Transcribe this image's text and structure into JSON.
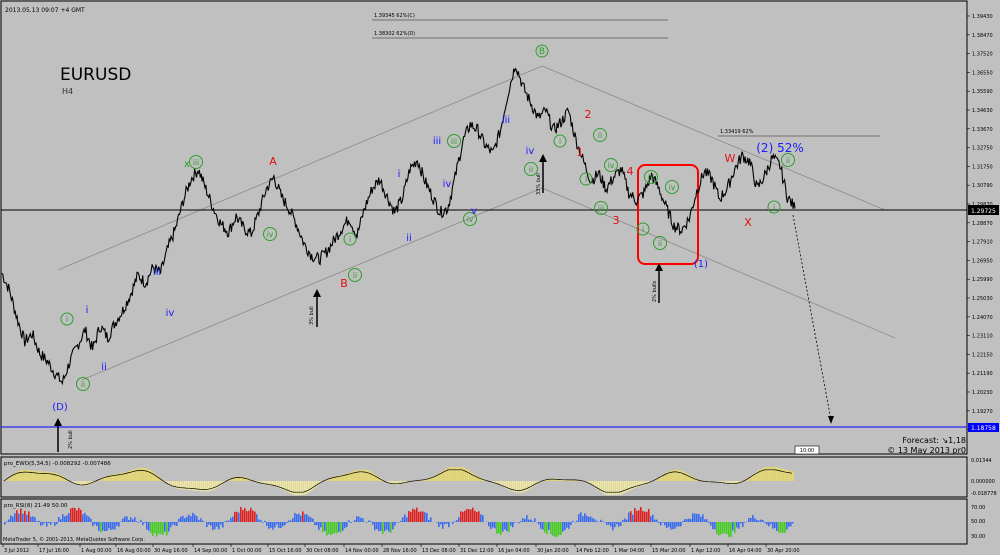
{
  "header": {
    "timestamp": "2013.05.13 09:07 +4 GMT",
    "symbol": "EURUSD",
    "timeframe": "H4",
    "fib_1": "1.39345 62%(C)",
    "fib_2": "1.38302 62%(D)",
    "fib_3": "1.33419 62%"
  },
  "price_axis": {
    "labels": [
      "1.39430",
      "1.38470",
      "1.37520",
      "1.36550",
      "1.35590",
      "1.34630",
      "1.33670",
      "1.32750",
      "1.31750",
      "1.30790",
      "1.29870",
      "1.28870",
      "1.27910",
      "1.26950",
      "1.25990",
      "1.25030",
      "1.24070",
      "1.23110",
      "1.22150",
      "1.21190",
      "1.20230",
      "1.19270",
      "1.18310"
    ],
    "current_price": "1.29725",
    "forecast_price": "1.18758"
  },
  "time_axis": {
    "labels": [
      "3 Jul 2012",
      "17 Jul 16:00",
      "1 Aug 00:00",
      "16 Aug 00:00",
      "30 Aug 16:00",
      "14 Sep 00:00",
      "1 Oct 00:00",
      "15 Oct 16:00",
      "30 Oct 08:00",
      "14 Nov 00:00",
      "28 Nov 16:00",
      "13 Dec 08:00",
      "31 Dec 12:00",
      "16 Jan 04:00",
      "30 Jan 20:00",
      "14 Feb 12:00",
      "1 Mar 04:00",
      "15 Mar 20:00",
      "1 Apr 12:00",
      "16 Apr 04:00",
      "30 Apr 20:00"
    ]
  },
  "forecast": {
    "line1": "Forecast: ↘1,18",
    "line2": "© 13 May 2013 pr0"
  },
  "scroll_label": "10:00",
  "indicators": {
    "ewo": {
      "label": "pro_EWO(5,34,5) -0.008292 -0.007486",
      "axis": [
        "0.000000",
        "-0.018778"
      ],
      "top_value": "0.01344"
    },
    "rsi": {
      "label": "pro_RSI(8) 21.49 50.00",
      "axis": [
        "70.00",
        "50.00",
        "30.00"
      ]
    }
  },
  "footer": {
    "copyright": "MetaTrader 5, © 2001-2013, MetaQuotes Software Corp."
  },
  "wave_labels": [
    {
      "text": "(D)",
      "kind": "blue"
    },
    {
      "text": "i",
      "kind": "green"
    },
    {
      "text": "ii",
      "kind": "green"
    },
    {
      "text": "i",
      "kind": "blue"
    },
    {
      "text": "ii",
      "kind": "blue"
    },
    {
      "text": "iii",
      "kind": "blue"
    },
    {
      "text": "iv",
      "kind": "blue"
    },
    {
      "text": "x",
      "kind": "green-plain"
    },
    {
      "text": "iii",
      "kind": "green"
    },
    {
      "text": "A",
      "kind": "red"
    },
    {
      "text": "iv",
      "kind": "green"
    },
    {
      "text": "B",
      "kind": "red"
    },
    {
      "text": "i",
      "kind": "green"
    },
    {
      "text": "ii",
      "kind": "green"
    },
    {
      "text": "i",
      "kind": "blue"
    },
    {
      "text": "ii",
      "kind": "blue"
    },
    {
      "text": "iii",
      "kind": "blue"
    },
    {
      "text": "iii",
      "kind": "green"
    },
    {
      "text": "iv",
      "kind": "blue"
    },
    {
      "text": "iv",
      "kind": "green"
    },
    {
      "text": "v",
      "kind": "blue"
    },
    {
      "text": "iii",
      "kind": "blue"
    },
    {
      "text": "iv",
      "kind": "blue"
    },
    {
      "text": "ii",
      "kind": "green"
    },
    {
      "text": "B",
      "kind": "green"
    },
    {
      "text": "i",
      "kind": "green"
    },
    {
      "text": "2",
      "kind": "red"
    },
    {
      "text": "ii",
      "kind": "green"
    },
    {
      "text": "1",
      "kind": "red"
    },
    {
      "text": "iv",
      "kind": "green"
    },
    {
      "text": "i",
      "kind": "green"
    },
    {
      "text": "iii",
      "kind": "green"
    },
    {
      "text": "3",
      "kind": "red"
    },
    {
      "text": "4",
      "kind": "red"
    },
    {
      "text": "iii",
      "kind": "green"
    },
    {
      "text": "iv",
      "kind": "green"
    },
    {
      "text": "i",
      "kind": "green"
    },
    {
      "text": "ii",
      "kind": "green"
    },
    {
      "text": "(1)",
      "kind": "blue"
    },
    {
      "text": "W",
      "kind": "red"
    },
    {
      "text": "X",
      "kind": "red"
    },
    {
      "text": "(2) 52%",
      "kind": "blue"
    },
    {
      "text": "ii",
      "kind": "green"
    },
    {
      "text": "i",
      "kind": "green"
    }
  ],
  "arrow_notes": [
    "2% bull",
    "3% bull",
    "33% bull",
    "2% bulls"
  ],
  "chart_data": {
    "type": "line",
    "title": "EURUSD",
    "xlabel": "",
    "ylabel": "",
    "ylim": [
      1.1813,
      1.3943
    ],
    "series": [
      {
        "values": [
          1.263,
          1.254,
          1.24,
          1.228,
          1.232,
          1.222,
          1.218,
          1.212,
          1.207,
          1.218,
          1.226,
          1.234,
          1.224,
          1.236,
          1.23,
          1.238,
          1.244,
          1.252,
          1.262,
          1.258,
          1.266,
          1.263,
          1.276,
          1.286,
          1.3,
          1.311,
          1.316,
          1.306,
          1.296,
          1.288,
          1.284,
          1.292,
          1.286,
          1.283,
          1.294,
          1.306,
          1.312,
          1.302,
          1.296,
          1.288,
          1.278,
          1.272,
          1.27,
          1.274,
          1.28,
          1.286,
          1.291,
          1.282,
          1.296,
          1.306,
          1.311,
          1.302,
          1.294,
          1.301,
          1.316,
          1.321,
          1.31,
          1.302,
          1.294,
          1.296,
          1.312,
          1.33,
          1.339,
          1.336,
          1.328,
          1.324,
          1.336,
          1.355,
          1.37,
          1.358,
          1.35,
          1.342,
          1.346,
          1.336,
          1.34,
          1.346,
          1.331,
          1.32,
          1.31,
          1.314,
          1.306,
          1.312,
          1.316,
          1.304,
          1.3,
          1.304,
          1.313,
          1.306,
          1.296,
          1.287,
          1.285,
          1.291,
          1.305,
          1.315,
          1.311,
          1.301,
          1.306,
          1.316,
          1.323,
          1.32,
          1.306,
          1.313,
          1.322,
          1.318,
          1.302,
          1.296
        ]
      }
    ]
  }
}
